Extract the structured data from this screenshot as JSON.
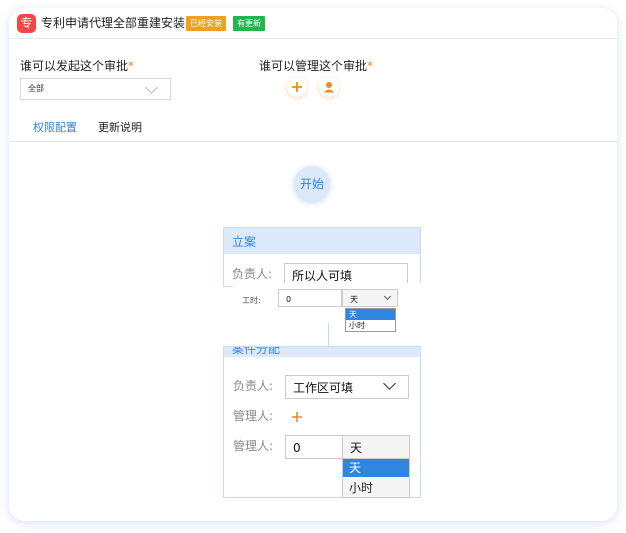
{
  "header": {
    "app_icon_char": "专",
    "title": "专利申请代理全部重建安装",
    "tag_installed": "已经安装",
    "tag_update": "有更新",
    "tag_installed_color": "#f0a020",
    "tag_update_color": "#20b74e"
  },
  "permissions": {
    "initiators_label": "谁可以发起这个审批",
    "initiators_value": "全部",
    "managers_label": "谁可以管理这个审批",
    "required_mark": "*",
    "add_icon": "plus-icon",
    "user_icon": "user-icon"
  },
  "tabs": [
    {
      "label": "权限配置",
      "active": true
    },
    {
      "label": "更新说明",
      "active": false
    }
  ],
  "flow": {
    "start_label": "开始",
    "node1": {
      "title": "立案",
      "owner_label": "负责人:",
      "owner_value": "所以人可填",
      "time_label": "工时:",
      "time_value": "0",
      "unit_value": "天",
      "unit_options": [
        "天",
        "小时"
      ]
    },
    "node2": {
      "title": "案件分配",
      "owner_label": "负责人:",
      "owner_value": "工作区可填",
      "manager_label": "管理人:",
      "hours_label": "管理人:",
      "hours_value": "0",
      "unit_value": "天",
      "unit_options": [
        "天",
        "小时"
      ]
    }
  },
  "colors": {
    "accent": "#2f86e0",
    "orange": "#f08a20",
    "node_head": "#dbe9fb"
  }
}
